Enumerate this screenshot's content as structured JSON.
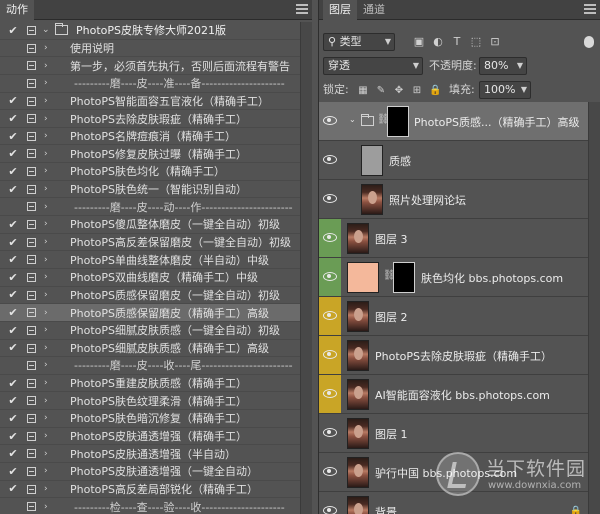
{
  "actions_panel": {
    "tab": "动作",
    "items": [
      {
        "check": "✔",
        "type": "set",
        "label": "PhotoPS皮肤专修大师2021版",
        "selected": false
      },
      {
        "check": "",
        "type": "action",
        "label": "使用说明",
        "selected": false
      },
      {
        "check": "",
        "type": "action",
        "label": "第一步，必须首先执行，否则后面流程有警告",
        "selected": false
      },
      {
        "check": "",
        "type": "sep",
        "label": "---------磨----皮----准----备---------------------",
        "selected": false
      },
      {
        "check": "✔",
        "type": "action",
        "label": "PhotoPS智能面容五官液化（精确手工）",
        "selected": false
      },
      {
        "check": "✔",
        "type": "action",
        "label": "PhotoPS去除皮肤瑕疵（精确手工）",
        "selected": false
      },
      {
        "check": "✔",
        "type": "action",
        "label": "PhotoPS名牌痘痕消（精确手工）",
        "selected": false
      },
      {
        "check": "✔",
        "type": "action",
        "label": "PhotoPS修复皮肤过曝（精确手工）",
        "selected": false
      },
      {
        "check": "✔",
        "type": "action",
        "label": "PhotoPS肤色均化（精确手工）",
        "selected": false
      },
      {
        "check": "✔",
        "type": "action",
        "label": "PhotoPS肤色统一（智能识别自动）",
        "selected": false
      },
      {
        "check": "",
        "type": "sep",
        "label": "---------磨----皮----动----作-----------------------",
        "selected": false
      },
      {
        "check": "✔",
        "type": "action",
        "label": "PhotoPS傻瓜整体磨皮（一键全自动）初级",
        "selected": false
      },
      {
        "check": "✔",
        "type": "action",
        "label": "PhotoPS高反差保留磨皮（一键全自动）初级",
        "selected": false
      },
      {
        "check": "✔",
        "type": "action",
        "label": "PhotoPS单曲线整体磨皮（半自动）中级",
        "selected": false
      },
      {
        "check": "✔",
        "type": "action",
        "label": "PhotoPS双曲线磨皮（精确手工）中级",
        "selected": false
      },
      {
        "check": "✔",
        "type": "action",
        "label": "PhotoPS质感保留磨皮（一键全自动）初级",
        "selected": false
      },
      {
        "check": "✔",
        "type": "action",
        "label": "PhotoPS质感保留磨皮（精确手工）高级",
        "selected": true
      },
      {
        "check": "✔",
        "type": "action",
        "label": "PhotoPS细腻皮肤质感（一键全自动）初级",
        "selected": false
      },
      {
        "check": "✔",
        "type": "action",
        "label": "PhotoPS细腻皮肤质感（精确手工）高级",
        "selected": false
      },
      {
        "check": "",
        "type": "sep",
        "label": "---------磨----皮----收----尾-----------------------",
        "selected": false
      },
      {
        "check": "✔",
        "type": "action",
        "label": "PhotoPS重建皮肤质感（精确手工）",
        "selected": false
      },
      {
        "check": "✔",
        "type": "action",
        "label": "PhotoPS肤色纹理柔滑（精确手工）",
        "selected": false
      },
      {
        "check": "✔",
        "type": "action",
        "label": "PhotoPS肤色暗沉修复（精确手工）",
        "selected": false
      },
      {
        "check": "✔",
        "type": "action",
        "label": "PhotoPS皮肤通透增强（精确手工）",
        "selected": false
      },
      {
        "check": "✔",
        "type": "action",
        "label": "PhotoPS皮肤通透增强（半自动）",
        "selected": false
      },
      {
        "check": "✔",
        "type": "action",
        "label": "PhotoPS皮肤通透增强（一键全自动）",
        "selected": false
      },
      {
        "check": "✔",
        "type": "action",
        "label": "PhotoPS高反差局部锐化（精确手工）",
        "selected": false
      },
      {
        "check": "",
        "type": "sep",
        "label": "---------检----查----验----收---------------------",
        "selected": false
      }
    ]
  },
  "layers_panel": {
    "tab_layers": "图层",
    "tab_channels": "通道",
    "filter_kind": "类型",
    "blend_mode": "穿透",
    "opacity_label": "不透明度:",
    "opacity_value": "80%",
    "lock_label": "锁定:",
    "fill_label": "填充:",
    "fill_value": "100%",
    "layers": [
      {
        "kind": "group",
        "name": "PhotoPS质感...（精确手工）高级",
        "color": "",
        "selected": true
      },
      {
        "kind": "grey",
        "name": "质感",
        "color": "",
        "selected": false,
        "indent": true
      },
      {
        "kind": "photo",
        "name": "照片处理网论坛",
        "color": "",
        "selected": false,
        "indent": true
      },
      {
        "kind": "photo",
        "name": "图层 3",
        "color": "#6a9c55",
        "selected": false
      },
      {
        "kind": "adjust",
        "name": "肤色均化 bbs.photops.com",
        "color": "#6a9c55",
        "selected": false
      },
      {
        "kind": "photo",
        "name": "图层 2",
        "color": "#c9a526",
        "selected": false
      },
      {
        "kind": "photo",
        "name": "PhotoPS去除皮肤瑕疵（精确手工）",
        "color": "#c9a526",
        "selected": false
      },
      {
        "kind": "photo",
        "name": "AI智能面容液化 bbs.photops.com",
        "color": "#c9a526",
        "selected": false
      },
      {
        "kind": "photo",
        "name": "图层 1",
        "color": "",
        "selected": false
      },
      {
        "kind": "photo",
        "name": "驴行中国 bbs.photops.com",
        "color": "",
        "selected": false
      },
      {
        "kind": "photo",
        "name": "背景",
        "color": "",
        "selected": false,
        "locked": true
      }
    ]
  },
  "watermark": {
    "line1": "当下软件园",
    "line2": "www.downxia.com"
  }
}
